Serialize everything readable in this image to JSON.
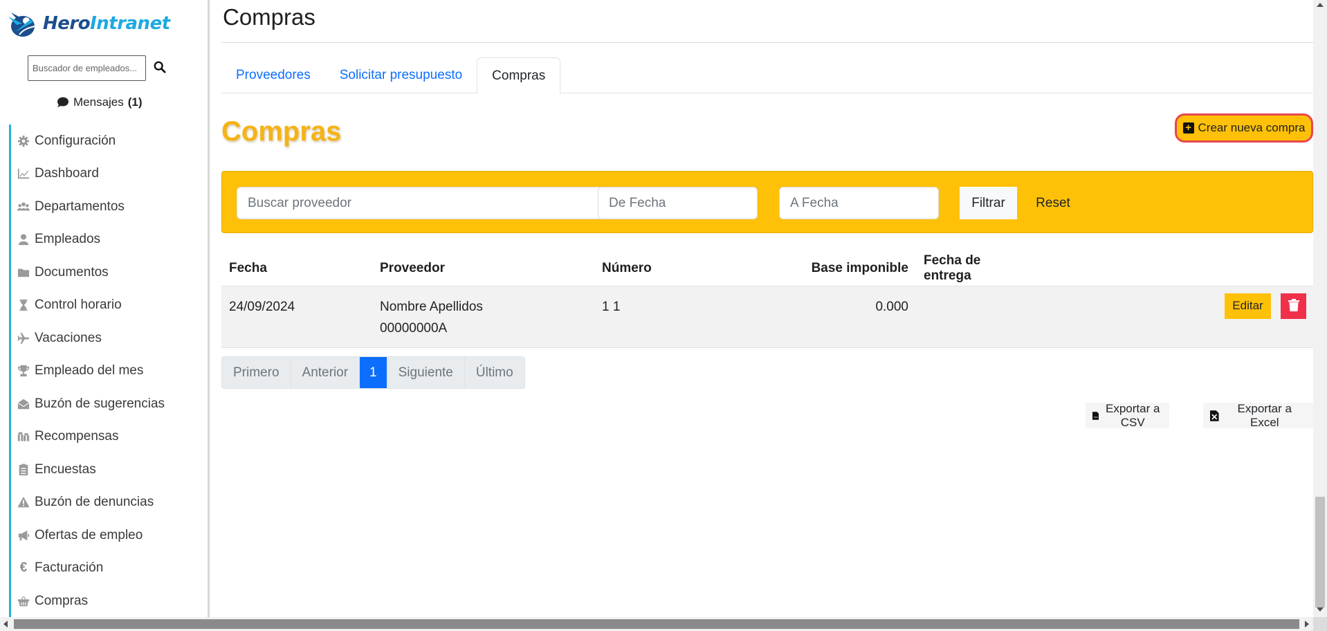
{
  "app": {
    "logo_part1": "Hero",
    "logo_part2": "Intranet"
  },
  "sidebar": {
    "search_placeholder": "Buscador de empleados...",
    "messages_label": "Mensajes",
    "messages_count": "(1)",
    "items": [
      {
        "label": "Configuración",
        "icon": "gear-icon"
      },
      {
        "label": "Dashboard",
        "icon": "chart-line-icon"
      },
      {
        "label": "Departamentos",
        "icon": "users-icon"
      },
      {
        "label": "Empleados",
        "icon": "user-icon"
      },
      {
        "label": "Documentos",
        "icon": "folder-icon"
      },
      {
        "label": "Control horario",
        "icon": "hourglass-icon"
      },
      {
        "label": "Vacaciones",
        "icon": "plane-icon"
      },
      {
        "label": "Empleado del mes",
        "icon": "trophy-icon"
      },
      {
        "label": "Buzón de sugerencias",
        "icon": "envelope-open-icon"
      },
      {
        "label": "Recompensas",
        "icon": "gifts-icon"
      },
      {
        "label": "Encuestas",
        "icon": "clipboard-list-icon"
      },
      {
        "label": "Buzón de denuncias",
        "icon": "warning-icon"
      },
      {
        "label": "Ofertas de empleo",
        "icon": "megaphone-icon"
      },
      {
        "label": "Facturación",
        "icon": "euro-icon"
      },
      {
        "label": "Compras",
        "icon": "basket-icon"
      }
    ]
  },
  "main": {
    "page_title": "Compras",
    "tabs": [
      {
        "label": "Proveedores",
        "active": false
      },
      {
        "label": "Solicitar presupuesto",
        "active": false
      },
      {
        "label": "Compras",
        "active": true
      }
    ],
    "section_title": "Compras",
    "new_button_label": "Crear nueva compra",
    "filters": {
      "supplier_placeholder": "Buscar proveedor",
      "from_placeholder": "De Fecha",
      "to_placeholder": "A Fecha",
      "filter_label": "Filtrar",
      "reset_label": "Reset"
    },
    "table": {
      "headers": [
        "Fecha",
        "Proveedor",
        "Número",
        "Base imponible",
        "Fecha de entrega"
      ],
      "rows": [
        {
          "fecha": "24/09/2024",
          "proveedor_name": "Nombre Apellidos",
          "proveedor_id": "00000000A",
          "numero": "1 1",
          "base": "0.000",
          "entrega": "",
          "edit_label": "Editar"
        }
      ]
    },
    "pagination": {
      "first": "Primero",
      "prev": "Anterior",
      "current": "1",
      "next": "Siguiente",
      "last": "Último"
    },
    "export_csv_label": "Exportar a CSV",
    "export_excel_label": "Exportar a Excel"
  },
  "colors": {
    "accent": "#ffc107",
    "primary": "#0d6efd",
    "danger": "#f0304a",
    "sidebar_border": "#27b0d6"
  }
}
